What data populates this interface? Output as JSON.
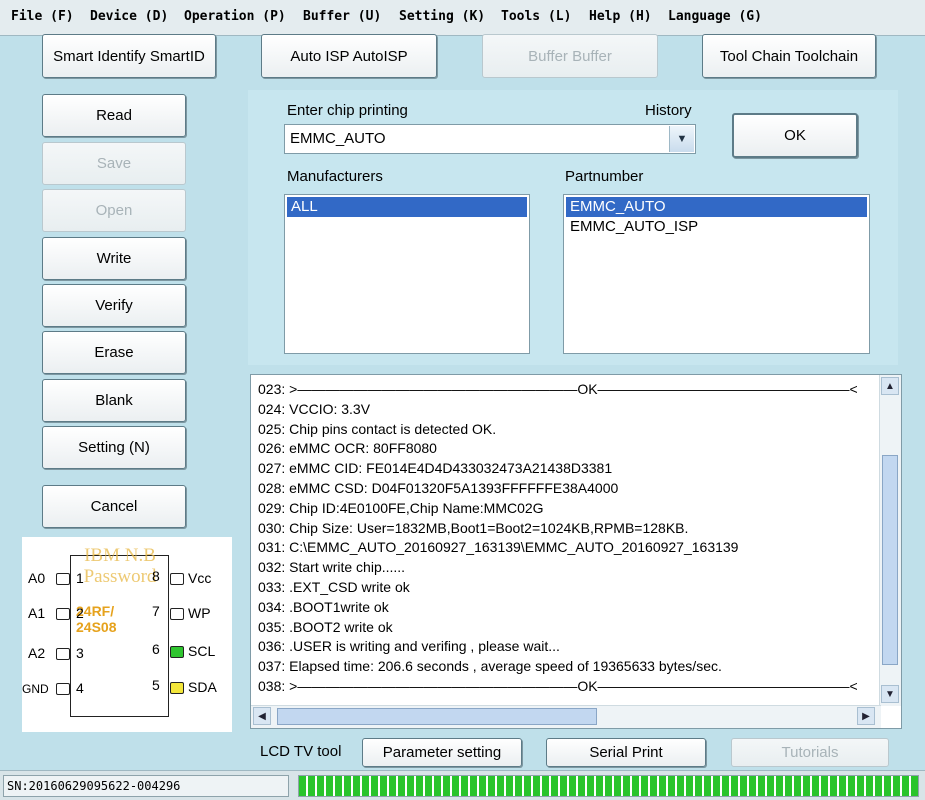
{
  "menu": [
    {
      "label": "File (F)"
    },
    {
      "label": "Device (D)"
    },
    {
      "label": "Operation (P)"
    },
    {
      "label": "Buffer (U)"
    },
    {
      "label": "Setting (K)"
    },
    {
      "label": "Tools (L)"
    },
    {
      "label": "Help (H)"
    },
    {
      "label": "Language (G)"
    }
  ],
  "top_buttons": {
    "smart_identify": "Smart Identify SmartID",
    "auto_isp": "Auto ISP AutoISP",
    "buffer": "Buffer Buffer",
    "tool_chain": "Tool Chain Toolchain"
  },
  "side_buttons": {
    "read": "Read",
    "save": "Save",
    "open": "Open",
    "write": "Write",
    "verify": "Verify",
    "erase": "Erase",
    "blank": "Blank",
    "setting": "Setting (N)",
    "cancel": "Cancel"
  },
  "chip": {
    "enter_label": "Enter chip printing",
    "history_label": "History",
    "value": "EMMC_AUTO",
    "ok_label": "OK",
    "manufacturers_label": "Manufacturers",
    "partnumber_label": "Partnumber",
    "manufacturers": [
      "ALL"
    ],
    "partnumbers": [
      "EMMC_AUTO",
      "EMMC_AUTO_ISP"
    ]
  },
  "log": [
    "023: >————————————————————OK——————————————————<",
    "024: VCCIO: 3.3V",
    "025: Chip pins contact is detected OK.",
    "026: eMMC OCR: 80FF8080",
    "027: eMMC CID:  FE014E4D4D433032473A21438D3381",
    "028: eMMC CSD: D04F01320F5A1393FFFFFFE38A4000",
    "029: Chip ID:4E0100FE,Chip Name:MMC02G",
    "030: Chip Size: User=1832MB,Boot1=Boot2=1024KB,RPMB=128KB.",
    "031:  C:\\EMMC_AUTO_20160927_163139\\EMMC_AUTO_20160927_163139",
    "032: Start write chip......",
    "033: .EXT_CSD write ok",
    "034: .BOOT1write ok",
    "035: .BOOT2 write ok",
    "036: .USER  is writing and verifing , please wait...",
    "037: Elapsed time: 206.6 seconds , average speed of 19365633 bytes/sec.",
    "038: >————————————————————OK——————————————————<"
  ],
  "bottom": {
    "lcd_label": "LCD TV tool",
    "parameter_setting": "Parameter setting",
    "serial_print": "Serial Print",
    "tutorials": "Tutorials"
  },
  "chip_diagram": {
    "overlay_line1": "IBM  N.B",
    "overlay_line2": "Password",
    "chip_text_line1": "24RF/",
    "chip_text_line2": "24S08",
    "left_pins": [
      {
        "label": "A0",
        "num": "1"
      },
      {
        "label": "A1",
        "num": "2"
      },
      {
        "label": "A2",
        "num": "3"
      },
      {
        "label": "GND",
        "num": "4"
      }
    ],
    "right_pins": [
      {
        "label": "Vcc",
        "num": "8",
        "color": "#ffffff"
      },
      {
        "label": "WP",
        "num": "7",
        "color": "#ffffff"
      },
      {
        "label": "SCL",
        "num": "6",
        "color": "#2fc52f"
      },
      {
        "label": "SDA",
        "num": "5",
        "color": "#f3e63a"
      }
    ]
  },
  "status": {
    "sn": "SN:20160629095622-004296",
    "progress_percent": 100
  },
  "colors": {
    "background": "#bfe0ea",
    "selection": "#3269c6",
    "progress": "#29c42b"
  }
}
